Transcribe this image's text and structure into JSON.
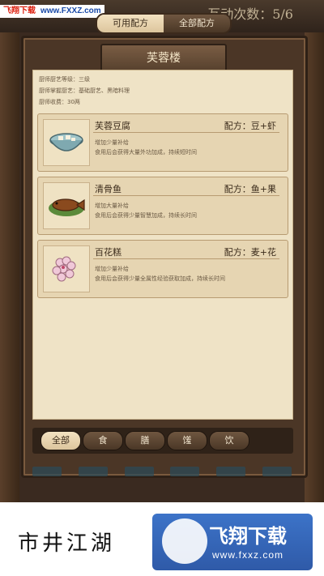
{
  "watermark_top": {
    "brand": "飞翔下载",
    "url": "www.FXXZ.com"
  },
  "counter": "互动次数：5/6",
  "tabs": [
    {
      "label": "可用配方",
      "active": true
    },
    {
      "label": "全部配方",
      "active": false
    }
  ],
  "restaurant_title": "芙蓉楼",
  "chef_info": [
    "厨师厨艺等级：三级",
    "厨师掌握厨艺：基础厨艺、黑暗料理",
    "厨师收费：30两"
  ],
  "dishes": [
    {
      "name": "芙蓉豆腐",
      "recipe": "配方：豆+虾",
      "line1": "增加少量补给",
      "line2": "食用后会获得大量外功加成，持续短时间",
      "icon": "tofu-bowl-icon"
    },
    {
      "name": "清骨鱼",
      "recipe": "配方：鱼+果",
      "line1": "增加大量补给",
      "line2": "食用后会获得少量智慧加成，持续长时间",
      "icon": "fish-dish-icon"
    },
    {
      "name": "百花糕",
      "recipe": "配方：麦+花",
      "line1": "增加少量补给",
      "line2": "食用后会获得少量全属性经验获取加成，持续长时间",
      "icon": "flower-cake-icon"
    }
  ],
  "filters": [
    {
      "label": "全部",
      "active": true
    },
    {
      "label": "食",
      "active": false
    },
    {
      "label": "膳",
      "active": false
    },
    {
      "label": "馐",
      "active": false
    },
    {
      "label": "饮",
      "active": false
    }
  ],
  "caption": "市井江湖",
  "logo": {
    "name": "飞翔下载",
    "url": "www.fxxz.com"
  },
  "colors": {
    "paper": "#efe3c6",
    "frame": "#4b3626",
    "accent_logo": "#3c73c8"
  }
}
